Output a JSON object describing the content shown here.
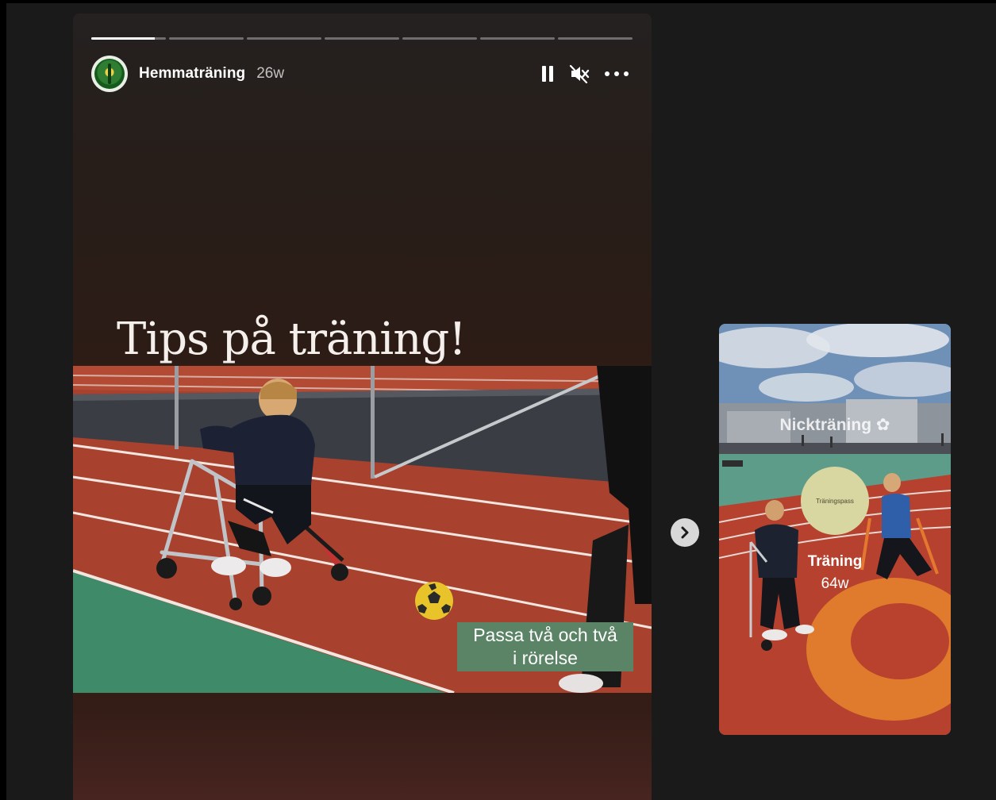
{
  "story": {
    "username": "Hemmaträning",
    "age": "26w",
    "title": "Tips på träning!",
    "caption_line1": "Passa två och två",
    "caption_line2": "i rörelse",
    "segments": [
      0.85,
      0,
      0,
      0,
      0,
      0,
      0
    ],
    "controls": {
      "pause_icon": "pause-icon",
      "mute_icon": "speaker-muted-icon",
      "more_icon": "more-horizontal-icon"
    }
  },
  "navigation": {
    "next_icon": "chevron-right-icon"
  },
  "preview": {
    "title": "Nickträning ✿",
    "badge": "Träningspass",
    "name": "Träning",
    "age": "64w"
  },
  "colors": {
    "background": "#1a1a1a",
    "caption_bg": "#5b8467",
    "track": "#a23e32",
    "field": "#3f8a69",
    "badge": "#d9d7a1"
  }
}
